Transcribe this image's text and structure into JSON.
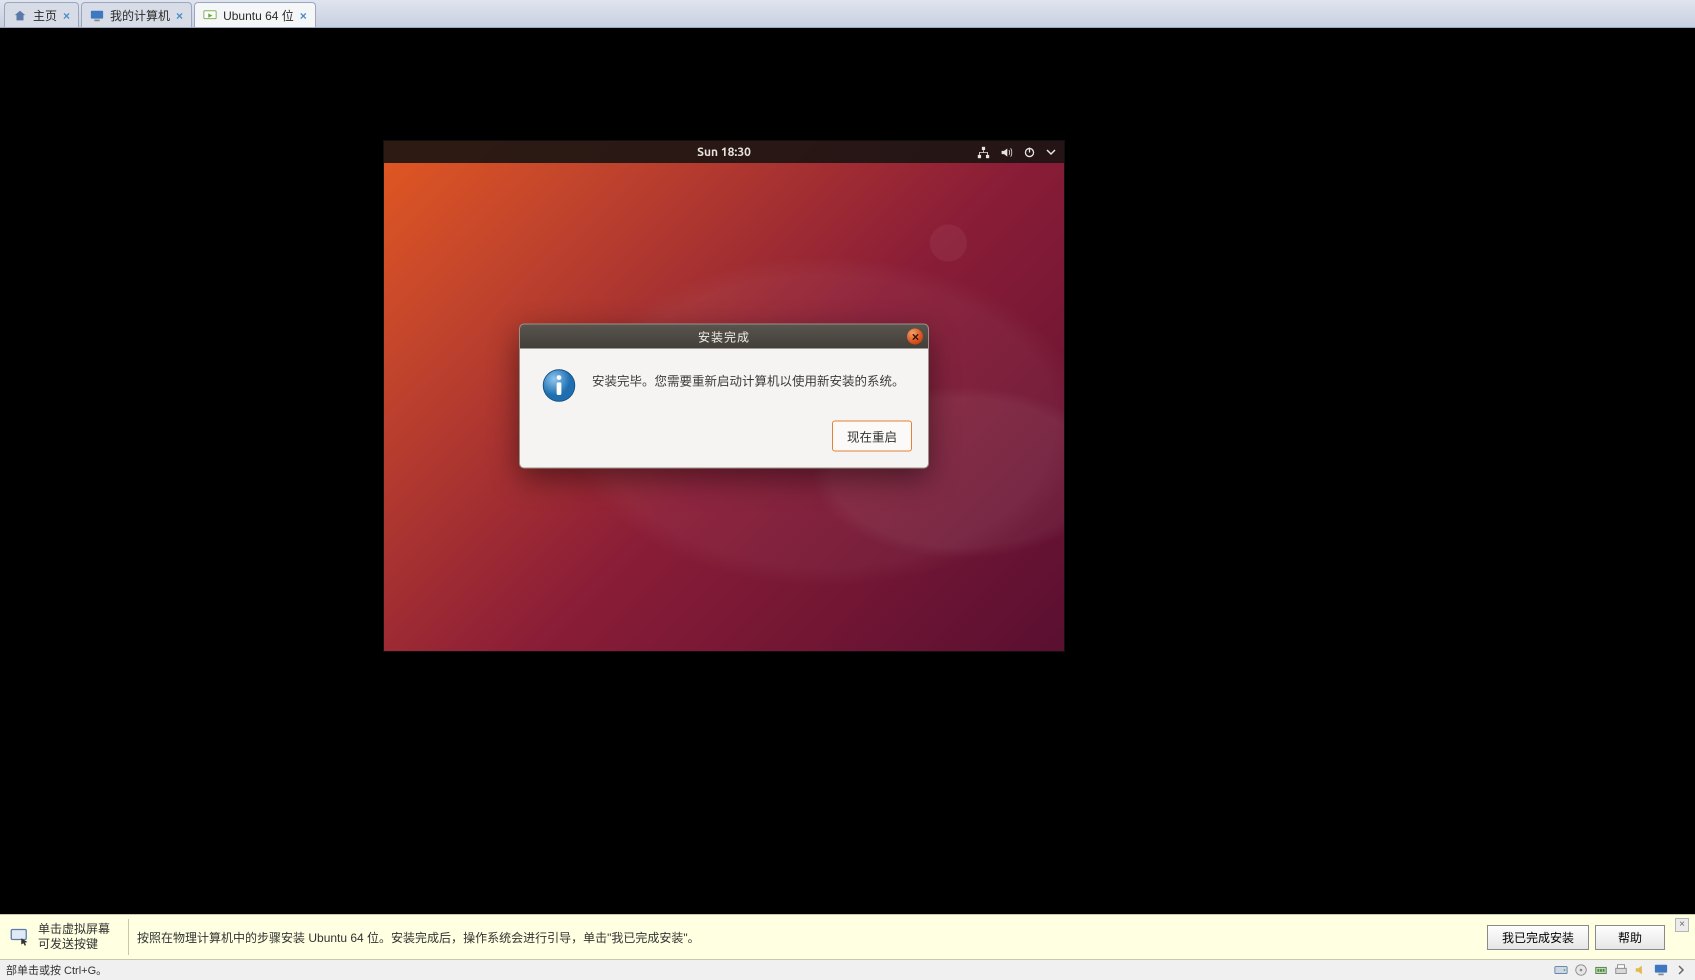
{
  "tabs": {
    "home": "主页",
    "mypc": "我的计算机",
    "ubuntu": "Ubuntu 64 位"
  },
  "guest": {
    "clock": "Sun 18:30",
    "dialog": {
      "title": "安装完成",
      "message": "安装完毕。您需要重新启动计算机以使用新安装的系统。",
      "restart_button": "现在重启"
    }
  },
  "hint": {
    "click_inside_line1": "单击虚拟屏幕",
    "click_inside_line2": "可发送按键",
    "install_instructions": "按照在物理计算机中的步骤安装 Ubuntu 64 位。安装完成后，操作系统会进行引导，单击\"我已完成安装\"。",
    "finished_button": "我已完成安装",
    "help_button": "帮助"
  },
  "status": {
    "hint": "部单击或按 Ctrl+G。"
  }
}
